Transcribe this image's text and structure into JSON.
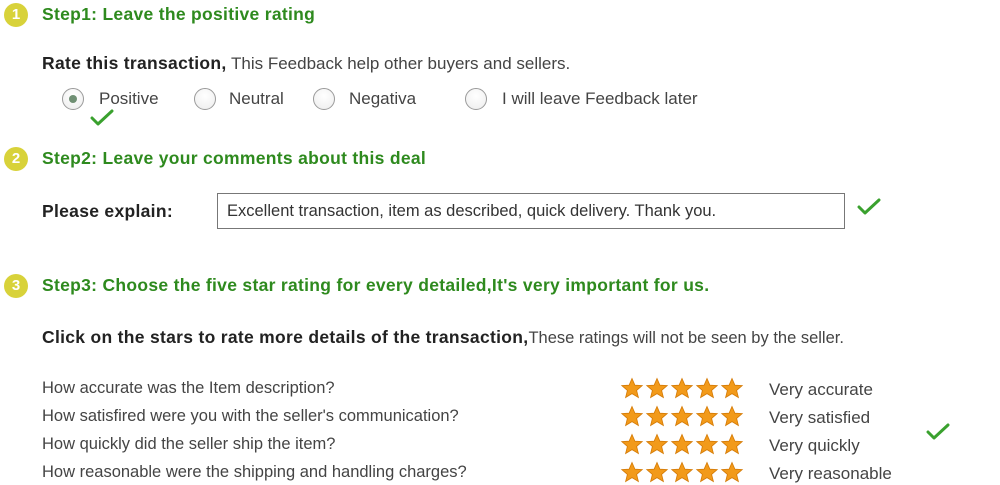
{
  "step1": {
    "number": "1",
    "title": "Step1: Leave the positive rating",
    "prompt_bold": "Rate this transaction,",
    "prompt_text": " This Feedback help other buyers and sellers.",
    "options": [
      {
        "label": "Positive",
        "selected": true
      },
      {
        "label": "Neutral",
        "selected": false
      },
      {
        "label": "Negativa",
        "selected": false
      },
      {
        "label": "I will leave Feedback later",
        "selected": false
      }
    ]
  },
  "step2": {
    "number": "2",
    "title": "Step2: Leave your comments about this deal",
    "label": "Please explain:",
    "comment_value": "Excellent transaction, item as described, quick delivery. Thank you."
  },
  "step3": {
    "number": "3",
    "title": "Step3: Choose the five star rating for every detailed,It's very important for us.",
    "prompt_bold": "Click on the stars to rate more details of the transaction,",
    "prompt_text": "These ratings will not be seen by the seller.",
    "ratings": [
      {
        "question": "How accurate was the Item description?",
        "stars": 5,
        "label": "Very accurate"
      },
      {
        "question": "How satisfired were you with the seller's communication?",
        "stars": 5,
        "label": "Very satisfied"
      },
      {
        "question": "How quickly did the seller ship the item?",
        "stars": 5,
        "label": "Very quickly"
      },
      {
        "question": "How reasonable were the shipping and handling charges?",
        "stars": 5,
        "label": "Very reasonable"
      }
    ]
  },
  "colors": {
    "step_title_green": "#2e8a1e",
    "step_circle_yellow": "#d8d23a",
    "check_green": "#3aa12e",
    "star_orange": "#f29a1a"
  },
  "icons": {
    "step_marker": "numbered-circle-icon",
    "check": "green-check-icon",
    "star": "orange-star-icon"
  }
}
